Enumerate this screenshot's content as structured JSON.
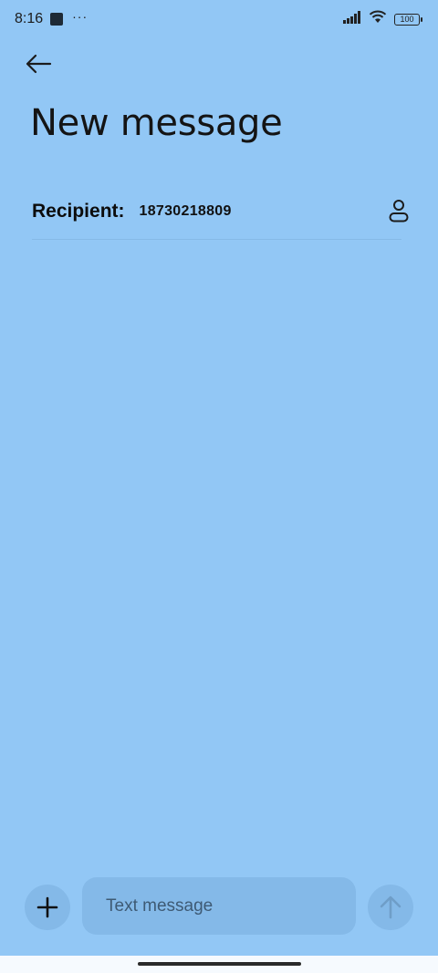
{
  "status_bar": {
    "time": "8:16",
    "dots": "···",
    "battery": "100",
    "icons": [
      "app-square-icon",
      "signal-icon",
      "wifi-icon",
      "battery-icon"
    ]
  },
  "header": {
    "back_icon": "arrow-left-icon",
    "title": "New message"
  },
  "recipient": {
    "label": "Recipient:",
    "value": "18730218809",
    "contact_icon": "person-icon"
  },
  "composer": {
    "add_icon": "plus-icon",
    "placeholder": "Text message",
    "send_icon": "arrow-up-icon"
  },
  "colors": {
    "background": "#92c7f5",
    "control": "#84b9e8"
  }
}
